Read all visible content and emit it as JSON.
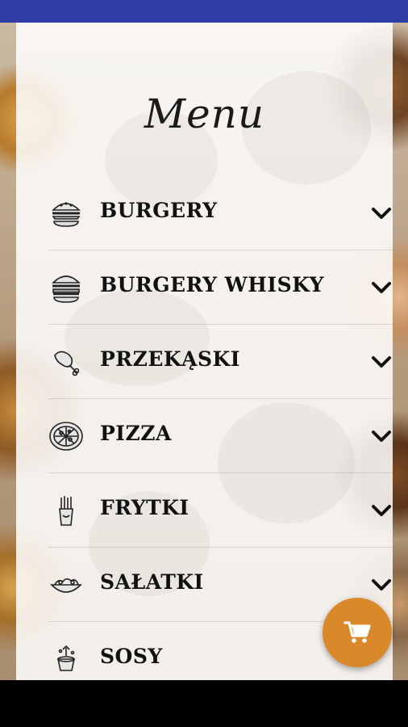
{
  "header": {
    "title": "Menu"
  },
  "menu": {
    "items": [
      {
        "label": "BURGERY",
        "icon": "burger-icon"
      },
      {
        "label": "BURGERY WHISKY",
        "icon": "burger-whisky-icon"
      },
      {
        "label": "PRZEKĄSKI",
        "icon": "chicken-leg-icon"
      },
      {
        "label": "PIZZA",
        "icon": "pizza-icon"
      },
      {
        "label": "FRYTKI",
        "icon": "fries-icon"
      },
      {
        "label": "SAŁATKI",
        "icon": "salad-bowl-icon"
      },
      {
        "label": "SOSY",
        "icon": "sauce-cup-icon"
      }
    ]
  },
  "cart": {
    "icon": "shopping-cart-icon",
    "color": "#d9892a"
  },
  "colors": {
    "status_bar": "#2f3ea6",
    "text": "#111111"
  }
}
